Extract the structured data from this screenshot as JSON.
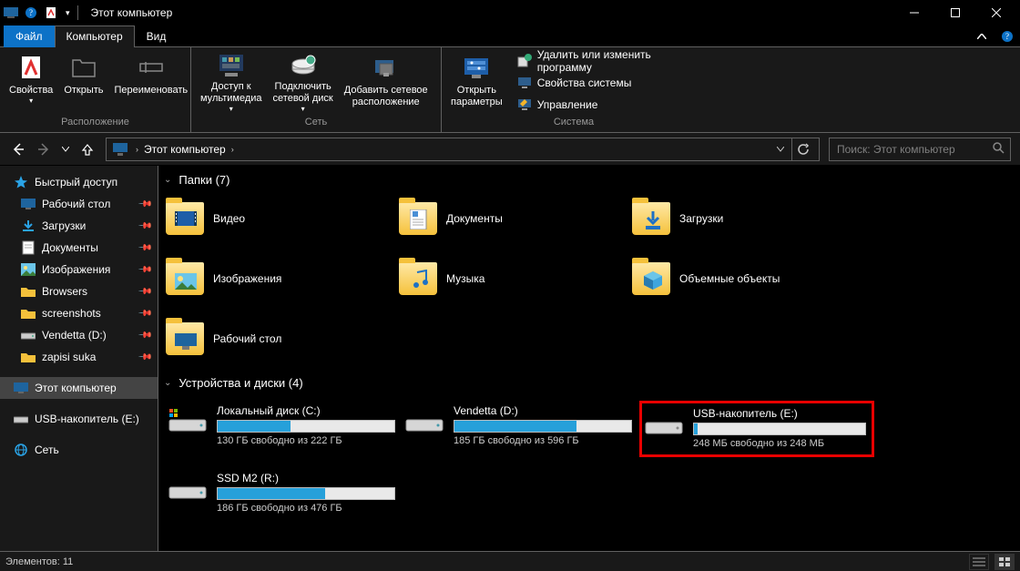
{
  "window": {
    "title": "Этот компьютер"
  },
  "tabs": {
    "file": "Файл",
    "computer": "Компьютер",
    "view": "Вид"
  },
  "ribbon": {
    "location": {
      "title": "Расположение",
      "properties": "Свойства",
      "open": "Открыть",
      "rename": "Переименовать"
    },
    "network": {
      "title": "Сеть",
      "media_access": "Доступ к\nмультимедиа",
      "map_drive": "Подключить\nсетевой диск",
      "add_location": "Добавить сетевое\nрасположение"
    },
    "openparams": {
      "open_settings": "Открыть\nпараметры"
    },
    "system": {
      "title": "Система",
      "uninstall": "Удалить или изменить программу",
      "sysprops": "Свойства системы",
      "manage": "Управление"
    }
  },
  "navigation": {
    "breadcrumb": "Этот компьютер"
  },
  "search": {
    "placeholder": "Поиск: Этот компьютер"
  },
  "sidebar": {
    "quick_access": "Быстрый доступ",
    "desktop": "Рабочий стол",
    "downloads": "Загрузки",
    "documents": "Документы",
    "pictures": "Изображения",
    "browsers": "Browsers",
    "screenshots": "screenshots",
    "vendetta": "Vendetta (D:)",
    "zapisi": "zapisi suka",
    "this_pc": "Этот компьютер",
    "usb": "USB-накопитель (E:)",
    "network": "Сеть"
  },
  "content": {
    "folders_header": "Папки (7)",
    "drives_header": "Устройства и диски (4)",
    "folders": {
      "videos": "Видео",
      "documents": "Документы",
      "downloads": "Загрузки",
      "pictures": "Изображения",
      "music": "Музыка",
      "objects3d": "Объемные объекты",
      "desktop": "Рабочий стол"
    },
    "drives": {
      "c": {
        "name": "Локальный диск (C:)",
        "free": "130 ГБ свободно из 222 ГБ",
        "fill": "41%"
      },
      "d": {
        "name": "Vendetta (D:)",
        "free": "185 ГБ свободно из 596 ГБ",
        "fill": "69%"
      },
      "e": {
        "name": "USB-накопитель (E:)",
        "free": "248 МБ свободно из 248 МБ",
        "fill": "2%"
      },
      "r": {
        "name": "SSD M2 (R:)",
        "free": "186 ГБ свободно из 476 ГБ",
        "fill": "61%"
      }
    }
  },
  "status": {
    "elements": "Элементов: 11"
  }
}
